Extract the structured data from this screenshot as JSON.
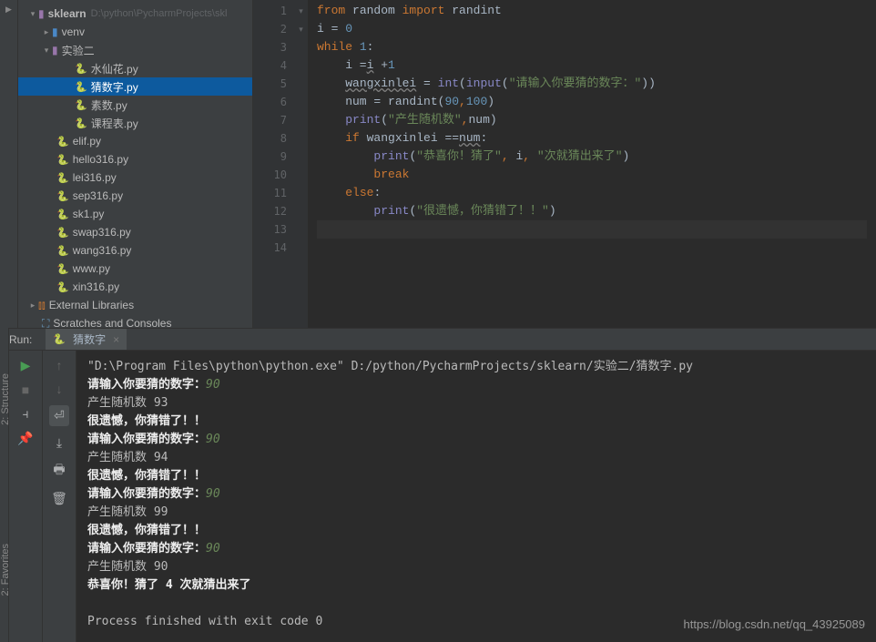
{
  "sidebar": {
    "project": {
      "name": "sklearn",
      "path": "D:\\python\\PycharmProjects\\skl"
    },
    "venv": "venv",
    "folder1": "实验二",
    "files_folder1": [
      "水仙花.py",
      "猜数字.py",
      "素数.py",
      "课程表.py"
    ],
    "root_files": [
      "elif.py",
      "hello316.py",
      "lei316.py",
      "sep316.py",
      "sk1.py",
      "swap316.py",
      "wang316.py",
      "www.py",
      "xin316.py"
    ],
    "external_libs": "External Libraries",
    "scratches": "Scratches and Consoles"
  },
  "editor": {
    "line_numbers": [
      "1",
      "2",
      "3",
      "4",
      "5",
      "6",
      "7",
      "8",
      "9",
      "10",
      "11",
      "12",
      "13",
      "14"
    ],
    "fold": [
      "",
      "",
      "▾",
      "",
      "",
      "",
      "",
      "▾",
      "",
      "",
      "",
      "",
      "",
      ""
    ],
    "code": [
      {
        "indent": 0,
        "tokens": [
          [
            "kw-orange",
            "from "
          ],
          [
            "",
            "random "
          ],
          [
            "kw-orange",
            "import "
          ],
          [
            "",
            "randint"
          ]
        ]
      },
      {
        "indent": 0,
        "tokens": [
          [
            "",
            "i = "
          ],
          [
            "num",
            "0"
          ]
        ]
      },
      {
        "indent": 0,
        "tokens": [
          [
            "kw-orange",
            "while "
          ],
          [
            "num",
            "1"
          ],
          [
            "",
            ":"
          ]
        ]
      },
      {
        "indent": 1,
        "tokens": [
          [
            "",
            "i ="
          ],
          [
            "typo",
            "i"
          ],
          [
            "",
            " +"
          ],
          [
            "num",
            "1"
          ]
        ]
      },
      {
        "indent": 1,
        "tokens": [
          [
            "typo",
            "wangxinlei"
          ],
          [
            "",
            " = "
          ],
          [
            "builtin",
            "int"
          ],
          [
            "",
            "("
          ],
          [
            "builtin",
            "input"
          ],
          [
            "",
            "("
          ],
          [
            "str",
            "\"请输入你要猜的数字：\""
          ],
          [
            "",
            "))"
          ]
        ]
      },
      {
        "indent": 1,
        "tokens": [
          [
            "",
            "num = randint("
          ],
          [
            "num",
            "90"
          ],
          [
            "kw-orange",
            ","
          ],
          [
            "num",
            "100"
          ],
          [
            "",
            ")"
          ]
        ]
      },
      {
        "indent": 1,
        "tokens": [
          [
            "builtin",
            "print"
          ],
          [
            "",
            "("
          ],
          [
            "str",
            "\"产生随机数\""
          ],
          [
            "kw-orange",
            ","
          ],
          [
            "",
            "num)"
          ]
        ]
      },
      {
        "indent": 1,
        "tokens": [
          [
            "kw-orange",
            "if "
          ],
          [
            "",
            "wangxinlei =="
          ],
          [
            "typo",
            "num"
          ],
          [
            "",
            ":"
          ]
        ]
      },
      {
        "indent": 2,
        "tokens": [
          [
            "builtin",
            "print"
          ],
          [
            "",
            "("
          ],
          [
            "str",
            "\"恭喜你！猜了\""
          ],
          [
            "kw-orange",
            ", "
          ],
          [
            "",
            "i"
          ],
          [
            "kw-orange",
            ", "
          ],
          [
            "str",
            "\"次就猜出来了\""
          ],
          [
            "",
            ")"
          ]
        ]
      },
      {
        "indent": 2,
        "tokens": [
          [
            "kw-orange",
            "break"
          ]
        ]
      },
      {
        "indent": 1,
        "tokens": [
          [
            "kw-orange",
            "else"
          ],
          [
            "",
            ":"
          ]
        ]
      },
      {
        "indent": 2,
        "tokens": [
          [
            "builtin",
            "print"
          ],
          [
            "",
            "("
          ],
          [
            "str",
            "\"很遗憾，你猜错了！！\""
          ],
          [
            "",
            ")"
          ]
        ]
      },
      {
        "indent": 0,
        "tokens": []
      },
      {
        "indent": 0,
        "tokens": []
      }
    ]
  },
  "run": {
    "header_label": "Run:",
    "tab_name": "猜数字",
    "output": [
      {
        "t": "plain",
        "v": "\"D:\\Program Files\\python\\python.exe\" D:/python/PycharmProjects/sklearn/实验二/猜数字.py"
      },
      {
        "t": "prompt",
        "p": "请输入你要猜的数字：",
        "i": "90"
      },
      {
        "t": "plain",
        "v": "产生随机数 93"
      },
      {
        "t": "bold",
        "v": "很遗憾，你猜错了！！"
      },
      {
        "t": "prompt",
        "p": "请输入你要猜的数字：",
        "i": "90"
      },
      {
        "t": "plain",
        "v": "产生随机数 94"
      },
      {
        "t": "bold",
        "v": "很遗憾，你猜错了！！"
      },
      {
        "t": "prompt",
        "p": "请输入你要猜的数字：",
        "i": "90"
      },
      {
        "t": "plain",
        "v": "产生随机数 99"
      },
      {
        "t": "bold",
        "v": "很遗憾，你猜错了！！"
      },
      {
        "t": "prompt",
        "p": "请输入你要猜的数字：",
        "i": "90"
      },
      {
        "t": "plain",
        "v": "产生随机数 90"
      },
      {
        "t": "bold",
        "v": "恭喜你！猜了 4 次就猜出来了"
      },
      {
        "t": "plain",
        "v": ""
      },
      {
        "t": "plain",
        "v": "Process finished with exit code 0"
      }
    ]
  },
  "left_tabs": {
    "structure": "2: Structure",
    "favorites": "2: Favorites"
  },
  "watermark": "https://blog.csdn.net/qq_43925089"
}
